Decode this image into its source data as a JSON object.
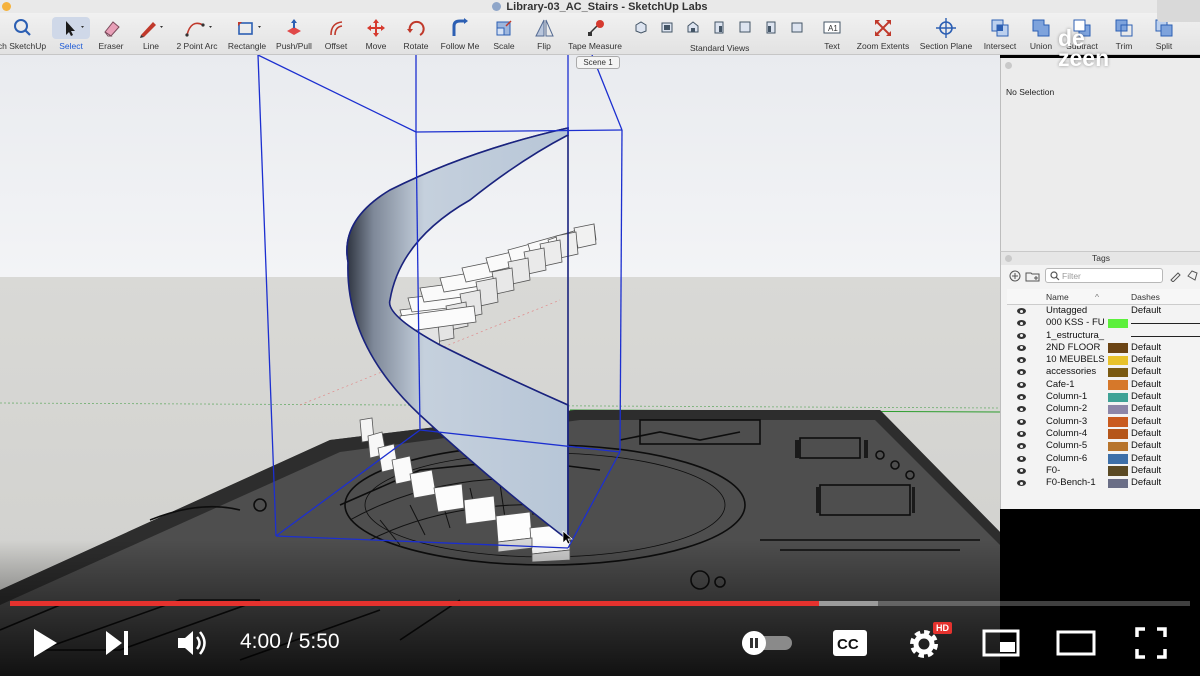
{
  "window": {
    "title": "Library-03_AC_Stairs - SketchUp Labs"
  },
  "toolbar": {
    "tools": [
      {
        "id": "search",
        "label": "ch SketchUp",
        "icon": "search-icon"
      },
      {
        "id": "select",
        "label": "Select",
        "icon": "cursor-arrow-icon",
        "active": true
      },
      {
        "id": "eraser",
        "label": "Eraser",
        "icon": "eraser-icon"
      },
      {
        "id": "line",
        "label": "Line",
        "icon": "pencil-icon"
      },
      {
        "id": "arc",
        "label": "2 Point Arc",
        "icon": "arc-icon"
      },
      {
        "id": "rectangle",
        "label": "Rectangle",
        "icon": "rectangle-icon"
      },
      {
        "id": "pushpull",
        "label": "Push/Pull",
        "icon": "push-pull-icon"
      },
      {
        "id": "offset",
        "label": "Offset",
        "icon": "offset-icon"
      },
      {
        "id": "move",
        "label": "Move",
        "icon": "move-arrows-icon"
      },
      {
        "id": "rotate",
        "label": "Rotate",
        "icon": "rotate-icon"
      },
      {
        "id": "followme",
        "label": "Follow Me",
        "icon": "follow-me-icon"
      },
      {
        "id": "scale",
        "label": "Scale",
        "icon": "scale-icon"
      },
      {
        "id": "flip",
        "label": "Flip",
        "icon": "flip-icon"
      },
      {
        "id": "tapemeasure",
        "label": "Tape Measure",
        "icon": "tape-measure-icon"
      },
      {
        "id": "text",
        "label": "Text",
        "icon": "text-icon"
      },
      {
        "id": "zoomextents",
        "label": "Zoom Extents",
        "icon": "zoom-extents-icon"
      },
      {
        "id": "sectionplane",
        "label": "Section Plane",
        "icon": "section-plane-icon"
      },
      {
        "id": "intersect",
        "label": "Intersect",
        "icon": "intersect-icon"
      },
      {
        "id": "union",
        "label": "Union",
        "icon": "union-icon"
      },
      {
        "id": "subtract",
        "label": "Subtract",
        "icon": "subtract-icon"
      },
      {
        "id": "trim",
        "label": "Trim",
        "icon": "trim-icon"
      },
      {
        "id": "split",
        "label": "Split",
        "icon": "split-icon"
      }
    ],
    "standard_views_label": "Standard Views"
  },
  "scene_tab": {
    "label": "Scene 1"
  },
  "entity_info": {
    "status": "No Selection"
  },
  "tags_panel": {
    "title": "Tags",
    "filter_placeholder": "Filter",
    "columns": {
      "name": "Name",
      "dashes": "Dashes"
    },
    "rows": [
      {
        "name": "Untagged",
        "color": "",
        "dashes": "Default"
      },
      {
        "name": "000 KSS - FU",
        "color": "#5cf03c",
        "dashes": "",
        "line": true
      },
      {
        "name": "1_estructura_",
        "color": "",
        "dashes": "",
        "line": true
      },
      {
        "name": "2ND FLOOR",
        "color": "#6b4414",
        "dashes": "Default"
      },
      {
        "name": "10 MEUBELS",
        "color": "#e8c22a",
        "dashes": "Default"
      },
      {
        "name": "accessories",
        "color": "#7a5a12",
        "dashes": "Default"
      },
      {
        "name": "Cafe-1",
        "color": "#d6782a",
        "dashes": "Default"
      },
      {
        "name": "Column-1",
        "color": "#3fa296",
        "dashes": "Default"
      },
      {
        "name": "Column-2",
        "color": "#8d86a8",
        "dashes": "Default"
      },
      {
        "name": "Column-3",
        "color": "#c95a1e",
        "dashes": "Default"
      },
      {
        "name": "Column-4",
        "color": "#b5561a",
        "dashes": "Default"
      },
      {
        "name": "Column-5",
        "color": "#b7742c",
        "dashes": "Default"
      },
      {
        "name": "Column-6",
        "color": "#3d6fa8",
        "dashes": "Default"
      },
      {
        "name": "F0-",
        "color": "#5b4a24",
        "dashes": "Default"
      },
      {
        "name": "F0-Bench-1",
        "color": "#6a6e86",
        "dashes": "Default"
      }
    ]
  },
  "logo": {
    "line1": "de",
    "line2": "zeen"
  },
  "video": {
    "current_time": "4:00",
    "duration": "5:50",
    "played_fraction": 0.686,
    "buffered_fraction": 0.736,
    "hd_badge": "HD",
    "cc_label": "CC"
  }
}
